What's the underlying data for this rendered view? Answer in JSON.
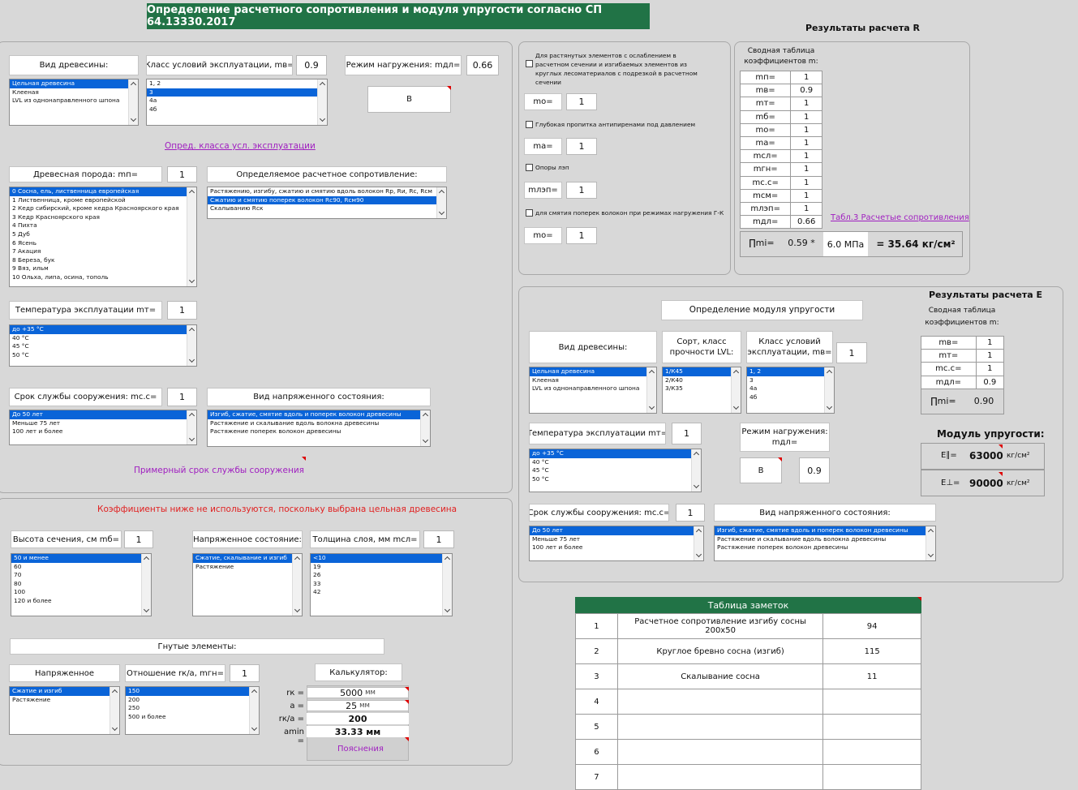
{
  "title": "Определение расчетного сопротивления и модуля упругости согласно СП 64.13330.2017",
  "colors": {
    "header_bg": "#217346",
    "selected": "#0a64d8",
    "link": "#a020c0",
    "warning": "#e02020"
  },
  "left": {
    "wood_type": {
      "label": "Вид древесины:",
      "items": [
        "Цельная древесина",
        "Клееная",
        "LVL из однонаправленного шпона"
      ],
      "selected": 0
    },
    "service_class": {
      "label": "Класс условий эксплуатации, mв=",
      "value": "0.9",
      "items": [
        "1, 2",
        "3",
        "4а",
        "4б"
      ],
      "selected": 1
    },
    "load_mode": {
      "label": "Режим нагружения: mдл=",
      "value": "0.66",
      "letter": "В"
    },
    "class_link": "Опред. класса усл. эксплуатации",
    "species": {
      "label": "Древесная порода: mп=",
      "value": "1",
      "items": [
        "0 Сосна, ель, лиственница европейская",
        "1 Лиственница, кроме европейской",
        "2 Кедр сибирский, кроме кедра Красноярского края",
        "3 Кедр Красноярского края",
        "4 Пихта",
        "5 Дуб",
        "6 Ясень",
        "7 Акация",
        "8 Береза, бук",
        "9 Вяз, ильм",
        "10 Ольха, липа, осина, тополь"
      ],
      "selected": 0
    },
    "resistance": {
      "label": "Определяемое расчетное сопротивление:",
      "items": [
        "Растяжению, изгибу, сжатию и смятию вдоль волокон Rр, Rи, Rс, Rсм",
        "Сжатию и смятию поперек волокон Rс90, Rсм90",
        "Скалыванию Rск"
      ],
      "selected": 1
    },
    "temperature": {
      "label": "Температура эксплуатации mт=",
      "value": "1",
      "items": [
        "до +35 °С",
        "40 °С",
        "45 °С",
        "50 °С"
      ],
      "selected": 0
    },
    "lifetime": {
      "label": "Срок службы сооружения: mс.с=",
      "value": "1",
      "items": [
        "До 50 лет",
        "Меньше 75 лет",
        "100 лет и более"
      ],
      "selected": 0
    },
    "stress": {
      "label": "Вид напряженного состояния:",
      "items": [
        "Изгиб, сжатие, смятие вдоль и поперек волокон древесины",
        "Растяжение и скалывание вдоль волокна древесины",
        "Растяжение поперек волокон древесины"
      ],
      "selected": 0
    },
    "lifetime_note": "Примерный срок службы сооружения"
  },
  "glulam": {
    "warning": "Коэффициенты ниже не используются, поскольку выбрана цельная древесина",
    "height": {
      "label": "Высота сечения, см mб=",
      "value": "1",
      "items": [
        "50 и менее",
        "60",
        "70",
        "80",
        "100",
        "120 и более"
      ],
      "selected": 0
    },
    "stress": {
      "label": "Напряженное состояние:",
      "items": [
        "Сжатие, скалывание и изгиб",
        "Растяжение"
      ],
      "selected": 0
    },
    "layer": {
      "label": "Толщина слоя, мм mсл=",
      "value": "1",
      "items": [
        "<10",
        "19",
        "26",
        "33",
        "42"
      ],
      "selected": 0
    },
    "bent": "Гнутые элементы:",
    "bent_stress": {
      "label": "Напряженное",
      "items": [
        "Сжатие и изгиб",
        "Растяжение"
      ],
      "selected": 0
    },
    "ratio": {
      "label": "Отношение rк/а, mгн=",
      "value": "1",
      "items": [
        "150",
        "200",
        "250",
        "500 и более"
      ],
      "selected": 0
    },
    "calc": {
      "label": "Калькулятор:",
      "r_label": "rк =",
      "r_value": "5000",
      "r_unit": "мм",
      "a_label": "а =",
      "a_value": "25",
      "a_unit": "мм",
      "ratio_label": "rк/а =",
      "ratio_value": "200",
      "amin_label": "аmin =",
      "amin_value": "33.33 мм",
      "explain": "Пояснения"
    }
  },
  "middle": {
    "cb1": "Для растянутых элементов с ослаблением в расчетном сечении и изгибаемых элементов из круглых лесоматериалов с подрезкой в расчетном сечении",
    "m0_label": "mo=",
    "m0_value": "1",
    "cb2": "Глубокая пропитка антипиренами под давлением",
    "ma_label": "mа=",
    "ma_value": "1",
    "cb3": "Опоры лэп",
    "mlep_label": "mлэп=",
    "mlep_value": "1",
    "cb4": "для смятия поперек волокон при режимах нагружения Г-К",
    "m0b_label": "mо=",
    "m0b_value": "1"
  },
  "results_r": {
    "title": "Результаты расчета R",
    "subtitle": "Сводная таблица коэффициентов m:",
    "rows": [
      [
        "mп=",
        "1"
      ],
      [
        "mв=",
        "0.9"
      ],
      [
        "mт=",
        "1"
      ],
      [
        "mб=",
        "1"
      ],
      [
        "mо=",
        "1"
      ],
      [
        "mа=",
        "1"
      ],
      [
        "mсл=",
        "1"
      ],
      [
        "mгн=",
        "1"
      ],
      [
        "mс.с=",
        "1"
      ],
      [
        "mсм=",
        "1"
      ],
      [
        "mлэп=",
        "1"
      ],
      [
        "mдл=",
        "0.66"
      ]
    ],
    "prod_label": "∏mi=",
    "prod_value": "0.59 *",
    "base": "6.0 МПа",
    "result": "= 35.64 кг/см²",
    "table_link": "Табл.3 Расчетые сопротивления"
  },
  "results_e": {
    "title": "Результаты расчета Е",
    "subtitle": "Сводная таблица коэффициентов m:",
    "section": "Определение модуля упругости",
    "wood_type": {
      "label": "Вид древесины:",
      "items": [
        "Цельная древесина",
        "Клееная",
        "LVL из однонаправленного шпона"
      ],
      "selected": 0
    },
    "grade": {
      "label": "Сорт, класс прочности LVL:",
      "items": [
        "1/К45",
        "2/К40",
        "3/К35"
      ],
      "selected": 0
    },
    "service_class": {
      "label": "Класс условий эксплуатации, mв=",
      "value": "1",
      "items": [
        "1, 2",
        "3",
        "4а",
        "4б"
      ],
      "selected": 0
    },
    "temperature": {
      "label": "Температура эксплуатации mт=",
      "value": "1",
      "items": [
        "до +35 °С",
        "40 °С",
        "45 °С",
        "50 °С"
      ],
      "selected": 0
    },
    "load_mode": {
      "label": "Режим нагружения: mдл=",
      "letter": "В",
      "value": "0.9"
    },
    "lifetime": {
      "label": "Срок службы сооружения: mс.с=",
      "value": "1",
      "items": [
        "До 50 лет",
        "Меньше 75 лет",
        "100 лет и более"
      ],
      "selected": 0
    },
    "stress": {
      "label": "Вид напряженного состояния:",
      "items": [
        "Изгиб, сжатие, смятие вдоль и поперек волокон древесины",
        "Растяжение и скалывание вдоль волокна древесины",
        "Растяжение поперек волокон древесины"
      ],
      "selected": 0
    },
    "rows": [
      [
        "mв=",
        "1"
      ],
      [
        "mт=",
        "1"
      ],
      [
        "mс.с=",
        "1"
      ],
      [
        "mдл=",
        "0.9"
      ]
    ],
    "prod_label": "∏mi=",
    "prod_value": "0.90",
    "modulus_title": "Модуль упругости:",
    "e1_label": "E∥=",
    "e1_value": "63000",
    "e2_label": "E⊥=",
    "e2_value": "90000",
    "unit": "кг/см²"
  },
  "notes": {
    "title": "Таблица заметок",
    "rows": [
      [
        "1",
        "Расчетное сопротивление изгибу сосны 200х50",
        "94"
      ],
      [
        "2",
        "Круглое бревно сосна (изгиб)",
        "115"
      ],
      [
        "3",
        "Скалывание сосна",
        "11"
      ],
      [
        "4",
        "",
        ""
      ],
      [
        "5",
        "",
        ""
      ],
      [
        "6",
        "",
        ""
      ],
      [
        "7",
        "",
        ""
      ]
    ]
  }
}
